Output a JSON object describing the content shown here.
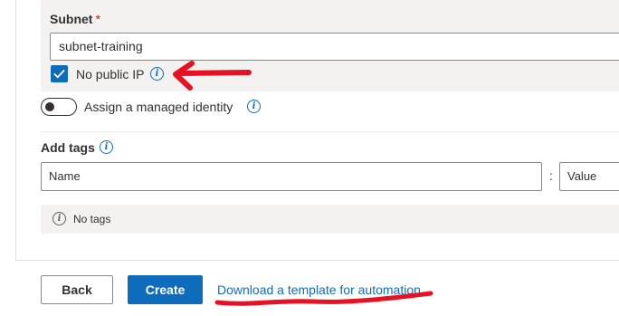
{
  "subnet": {
    "label": "Subnet",
    "required_marker": "*",
    "value": "subnet-training"
  },
  "public_ip": {
    "label": "No public IP",
    "checked": true
  },
  "managed_identity": {
    "label": "Assign a managed identity",
    "enabled": false
  },
  "tags": {
    "title": "Add tags",
    "name_placeholder": "Name",
    "separator": ":",
    "value_placeholder": "Value",
    "empty_message": "No tags"
  },
  "footer": {
    "back_label": "Back",
    "create_label": "Create",
    "download_link": "Download a template for automation"
  },
  "colors": {
    "accent": "#0f6cbd",
    "annotation": "#e81123",
    "panel": "#f3f2f1"
  }
}
